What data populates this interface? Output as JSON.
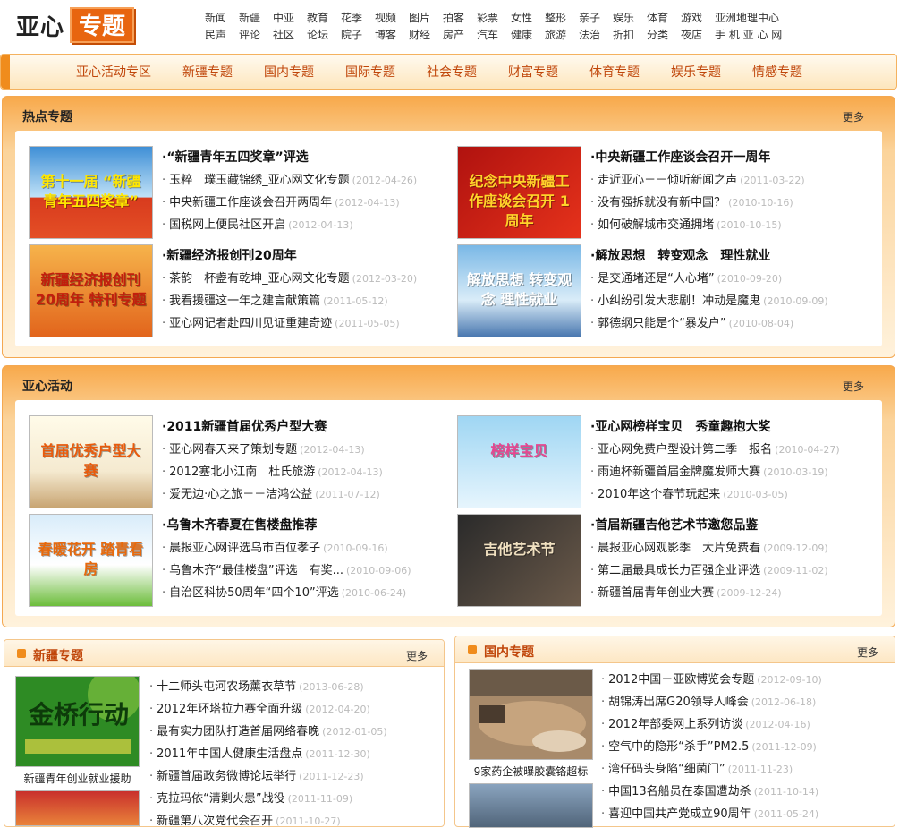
{
  "logo": {
    "text_a": "亚心",
    "text_b": "专题"
  },
  "topnav": {
    "row1": [
      "新闻",
      "新疆",
      "中亚",
      "教育",
      "花季",
      "视频",
      "图片",
      "拍客",
      "彩票",
      "女性",
      "整形",
      "亲子",
      "娱乐",
      "体育",
      "游戏",
      "亚洲地理中心"
    ],
    "row2": [
      "民声",
      "评论",
      "社区",
      "论坛",
      "院子",
      "博客",
      "财经",
      "房产",
      "汽车",
      "健康",
      "旅游",
      "法治",
      "折扣",
      "分类",
      "夜店",
      "手 机 亚 心 网"
    ]
  },
  "mainnav": [
    "亚心活动专区",
    "新疆专题",
    "国内专题",
    "国际专题",
    "社会专题",
    "财富专题",
    "体育专题",
    "娱乐专题",
    "情感专题"
  ],
  "hot": {
    "title": "热点专题",
    "more": "更多",
    "features": [
      {
        "img_text": "第十一届 “新疆青年五四奖章”",
        "title": "·“新疆青年五四奖章”评选",
        "items": [
          {
            "t": "玉粹　璞玉藏锦绣_亚心网文化专题",
            "d": "(2012-04-26)"
          },
          {
            "t": "中央新疆工作座谈会召开两周年",
            "d": "(2012-04-13)"
          },
          {
            "t": "国税网上便民社区开启",
            "d": "(2012-04-13)"
          }
        ]
      },
      {
        "img_text": "纪念中央新疆工作座谈会召开 1周年",
        "title": "·中央新疆工作座谈会召开一周年",
        "items": [
          {
            "t": "走近亚心－－倾听新闻之声",
            "d": "(2011-03-22)"
          },
          {
            "t": "没有强拆就没有新中国？",
            "d": "(2010-10-16)"
          },
          {
            "t": "如何破解城市交通拥堵",
            "d": "(2010-10-15)"
          }
        ]
      },
      {
        "img_text": "新疆经济报创刊20周年 特刊专题",
        "title": "·新疆经济报创刊20周年",
        "items": [
          {
            "t": "茶韵　杯盏有乾坤_亚心网文化专题",
            "d": "(2012-03-20)"
          },
          {
            "t": "我看援疆这一年之建言献策篇",
            "d": "(2011-05-12)"
          },
          {
            "t": "亚心网记者赴四川见证重建奇迹",
            "d": "(2011-05-05)"
          }
        ]
      },
      {
        "img_text": "解放思想 转变观念 理性就业",
        "title": "·解放思想　转变观念　理性就业",
        "items": [
          {
            "t": "是交通堵还是“人心堵”",
            "d": "(2010-09-20)"
          },
          {
            "t": "小纠纷引发大悲剧！冲动是魔鬼",
            "d": "(2010-09-09)"
          },
          {
            "t": "郭德纲只能是个“暴发户”",
            "d": "(2010-08-04)"
          }
        ]
      }
    ]
  },
  "activity": {
    "title": "亚心活动",
    "more": "更多",
    "features": [
      {
        "img_text": "首届优秀户型大赛",
        "title": "·2011新疆首届优秀户型大赛",
        "items": [
          {
            "t": "亚心网春天来了策划专题",
            "d": "(2012-04-13)"
          },
          {
            "t": "2012塞北小江南　杜氏旅游",
            "d": "(2012-04-13)"
          },
          {
            "t": "爱无边·心之旅－－洁鸿公益",
            "d": "(2011-07-12)"
          }
        ]
      },
      {
        "img_text": "榜样宝贝",
        "title": "·亚心网榜样宝贝　秀童趣抱大奖",
        "items": [
          {
            "t": "亚心网免费户型设计第二季　报名",
            "d": "(2010-04-27)"
          },
          {
            "t": "雨迪杯新疆首届金牌魔发师大赛",
            "d": "(2010-03-19)"
          },
          {
            "t": "2010年这个春节玩起来",
            "d": "(2010-03-05)"
          }
        ]
      },
      {
        "img_text": "春暖花开 踏青看房",
        "title": "·乌鲁木齐春夏在售楼盘推荐",
        "items": [
          {
            "t": "晨报亚心网评选乌市百位孝子",
            "d": "(2010-09-16)"
          },
          {
            "t": "乌鲁木齐“最佳楼盘”评选　有奖...",
            "d": "(2010-09-06)"
          },
          {
            "t": "自治区科协50周年“四个10”评选",
            "d": "(2010-06-24)"
          }
        ]
      },
      {
        "img_text": "吉他艺术节",
        "title": "·首届新疆吉他艺术节邀您品鉴",
        "items": [
          {
            "t": "晨报亚心网观影季　大片免费看",
            "d": "(2009-12-09)"
          },
          {
            "t": "第二届最具成长力百强企业评选",
            "d": "(2009-11-02)"
          },
          {
            "t": "新疆首届青年创业大赛",
            "d": "(2009-12-24)"
          }
        ]
      }
    ]
  },
  "xinjiang": {
    "title": "新疆专题",
    "more": "更多",
    "img_text": "金桥行动",
    "caption": "新疆青年创业就业援助",
    "items": [
      {
        "t": "十二师头屯河农场薰衣草节",
        "d": "(2013-06-28)"
      },
      {
        "t": "2012年环塔拉力赛全面升级",
        "d": "(2012-04-20)"
      },
      {
        "t": "最有实力团队打造首届网络春晚",
        "d": "(2012-01-05)"
      },
      {
        "t": "2011年中国人健康生活盘点",
        "d": "(2011-12-30)"
      },
      {
        "t": "新疆首届政务微博论坛举行",
        "d": "(2011-12-23)"
      },
      {
        "t": "克拉玛依“清剿火患”战役",
        "d": "(2011-11-09)"
      },
      {
        "t": "新疆第八次党代会召开",
        "d": "(2011-10-27)"
      }
    ]
  },
  "domestic": {
    "title": "国内专题",
    "more": "更多",
    "caption": "9家药企被曝胶囊铬超标",
    "items": [
      {
        "t": "2012中国－亚欧博览会专题",
        "d": "(2012-09-10)"
      },
      {
        "t": "胡锦涛出席G20领导人峰会",
        "d": "(2012-06-18)"
      },
      {
        "t": "2012年部委网上系列访谈",
        "d": "(2012-04-16)"
      },
      {
        "t": "空气中的隐形“杀手”PM2.5",
        "d": "(2011-12-09)"
      },
      {
        "t": "湾仔码头身陷“细菌门”",
        "d": "(2011-11-23)"
      },
      {
        "t": "中国13名船员在泰国遭劫杀",
        "d": "(2011-10-14)"
      },
      {
        "t": "喜迎中国共产党成立90周年",
        "d": "(2011-05-24)"
      }
    ]
  },
  "colors": {
    "accent": "#f08c1c",
    "nav_text": "#c0460a",
    "date": "#bbbbbb"
  }
}
